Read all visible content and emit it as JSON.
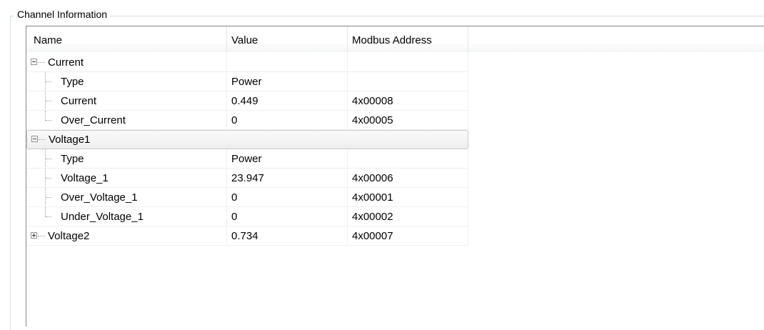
{
  "group": {
    "title": "Channel Information"
  },
  "columns": {
    "name": "Name",
    "value": "Value",
    "address": "Modbus Address"
  },
  "tree": [
    {
      "name": "Current",
      "value": "",
      "address": "",
      "expanded": true,
      "children": [
        {
          "name": "Type",
          "value": "Power",
          "address": ""
        },
        {
          "name": "Current",
          "value": "0.449",
          "address": "4x00008"
        },
        {
          "name": "Over_Current",
          "value": "0",
          "address": "4x00005"
        }
      ]
    },
    {
      "name": "Voltage1",
      "value": "",
      "address": "",
      "expanded": true,
      "selected": true,
      "children": [
        {
          "name": "Type",
          "value": "Power",
          "address": ""
        },
        {
          "name": "Voltage_1",
          "value": "23.947",
          "address": "4x00006"
        },
        {
          "name": "Over_Voltage_1",
          "value": "0",
          "address": "4x00001"
        },
        {
          "name": "Under_Voltage_1",
          "value": "0",
          "address": "4x00002"
        }
      ]
    },
    {
      "name": "Voltage2",
      "value": "0.734",
      "address": "4x00007",
      "expanded": false,
      "children": []
    }
  ],
  "icons": {
    "expanded": "collapse-minus-icon",
    "collapsed": "expand-plus-icon"
  }
}
